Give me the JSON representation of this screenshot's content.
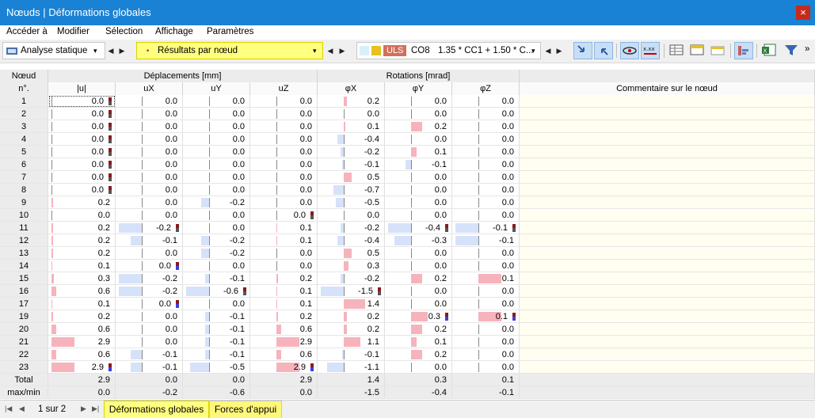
{
  "window": {
    "title": "Nœuds | Déformations globales",
    "close": "×"
  },
  "menu": [
    "Accéder à",
    "Modifier",
    "Sélection",
    "Affichage",
    "Paramètres"
  ],
  "toolbar": {
    "analysis": "Analyse statique",
    "results": "Résultats par nœud",
    "uls": "ULS",
    "combo_id": "CO8",
    "combo_expr": "1.35 * CC1 + 1.50 * C...",
    "more": "»",
    "colors": {
      "uls": "#d2705c",
      "highlight": "#ffff80",
      "combo_swatch": "#e8c020"
    }
  },
  "table": {
    "node_header": [
      "Nœud",
      "n°."
    ],
    "group_disp": "Déplacements [mm]",
    "group_rot": "Rotations [mrad]",
    "comment_header": "Commentaire sur le nœud",
    "columns": [
      "|u|",
      "uX",
      "uY",
      "uZ",
      "φX",
      "φY",
      "φZ"
    ],
    "rows": [
      {
        "n": "1",
        "v": [
          "0.0",
          "0.0",
          "0.0",
          "0.0",
          "0.2",
          "0.0",
          "0.0"
        ]
      },
      {
        "n": "2",
        "v": [
          "0.0",
          "0.0",
          "0.0",
          "0.0",
          "0.0",
          "0.0",
          "0.0"
        ]
      },
      {
        "n": "3",
        "v": [
          "0.0",
          "0.0",
          "0.0",
          "0.0",
          "0.1",
          "0.2",
          "0.0"
        ]
      },
      {
        "n": "4",
        "v": [
          "0.0",
          "0.0",
          "0.0",
          "0.0",
          "-0.4",
          "0.0",
          "0.0"
        ]
      },
      {
        "n": "5",
        "v": [
          "0.0",
          "0.0",
          "0.0",
          "0.0",
          "-0.2",
          "0.1",
          "0.0"
        ]
      },
      {
        "n": "6",
        "v": [
          "0.0",
          "0.0",
          "0.0",
          "0.0",
          "-0.1",
          "-0.1",
          "0.0"
        ]
      },
      {
        "n": "7",
        "v": [
          "0.0",
          "0.0",
          "0.0",
          "0.0",
          "0.5",
          "0.0",
          "0.0"
        ]
      },
      {
        "n": "8",
        "v": [
          "0.0",
          "0.0",
          "0.0",
          "0.0",
          "-0.7",
          "0.0",
          "0.0"
        ]
      },
      {
        "n": "9",
        "v": [
          "0.2",
          "0.0",
          "-0.2",
          "0.0",
          "-0.5",
          "0.0",
          "0.0"
        ]
      },
      {
        "n": "10",
        "v": [
          "0.0",
          "0.0",
          "0.0",
          "0.0",
          "0.0",
          "0.0",
          "0.0"
        ]
      },
      {
        "n": "11",
        "v": [
          "0.2",
          "-0.2",
          "0.0",
          "0.1",
          "-0.2",
          "-0.4",
          "-0.1"
        ]
      },
      {
        "n": "12",
        "v": [
          "0.2",
          "-0.1",
          "-0.2",
          "0.1",
          "-0.4",
          "-0.3",
          "-0.1"
        ]
      },
      {
        "n": "13",
        "v": [
          "0.2",
          "0.0",
          "-0.2",
          "0.0",
          "0.5",
          "0.0",
          "0.0"
        ]
      },
      {
        "n": "14",
        "v": [
          "0.1",
          "0.0",
          "0.0",
          "0.0",
          "0.3",
          "0.0",
          "0.0"
        ]
      },
      {
        "n": "15",
        "v": [
          "0.3",
          "-0.2",
          "-0.1",
          "0.2",
          "-0.2",
          "0.2",
          "0.1"
        ]
      },
      {
        "n": "16",
        "v": [
          "0.6",
          "-0.2",
          "-0.6",
          "0.1",
          "-1.5",
          "0.0",
          "0.0"
        ]
      },
      {
        "n": "17",
        "v": [
          "0.1",
          "0.0",
          "0.0",
          "0.1",
          "1.4",
          "0.0",
          "0.0"
        ]
      },
      {
        "n": "19",
        "v": [
          "0.2",
          "0.0",
          "-0.1",
          "0.2",
          "0.2",
          "0.3",
          "0.1"
        ]
      },
      {
        "n": "20",
        "v": [
          "0.6",
          "0.0",
          "-0.1",
          "0.6",
          "0.2",
          "0.2",
          "0.0"
        ]
      },
      {
        "n": "21",
        "v": [
          "2.9",
          "0.0",
          "-0.1",
          "2.9",
          "1.1",
          "0.1",
          "0.0"
        ]
      },
      {
        "n": "22",
        "v": [
          "0.6",
          "-0.1",
          "-0.1",
          "0.6",
          "-0.1",
          "0.2",
          "0.0"
        ]
      },
      {
        "n": "23",
        "v": [
          "2.9",
          "-0.1",
          "-0.5",
          "2.9",
          "-1.1",
          "0.0",
          "0.0"
        ]
      }
    ],
    "max_abs": [
      2.9,
      0.2,
      0.6,
      2.9,
      1.5,
      0.4,
      0.1
    ],
    "summary": [
      {
        "label": "Total",
        "v": [
          "2.9",
          "0.0",
          "0.0",
          "2.9",
          "1.4",
          "0.3",
          "0.1"
        ]
      },
      {
        "label": "max/min",
        "v": [
          "0.0",
          "-0.2",
          "-0.6",
          "0.0",
          "-1.5",
          "-0.4",
          "-0.1"
        ]
      }
    ],
    "extreme_markers": [
      {
        "row": "1",
        "col": 0,
        "kind": "red"
      },
      {
        "row": "2",
        "col": 0,
        "kind": "red"
      },
      {
        "row": "3",
        "col": 0,
        "kind": "red"
      },
      {
        "row": "4",
        "col": 0,
        "kind": "red"
      },
      {
        "row": "5",
        "col": 0,
        "kind": "red"
      },
      {
        "row": "6",
        "col": 0,
        "kind": "red"
      },
      {
        "row": "7",
        "col": 0,
        "kind": "red"
      },
      {
        "row": "8",
        "col": 0,
        "kind": "red"
      },
      {
        "row": "10",
        "col": 3,
        "kind": "red"
      },
      {
        "row": "11",
        "col": 1,
        "kind": "red"
      },
      {
        "row": "11",
        "col": 5,
        "kind": "red"
      },
      {
        "row": "11",
        "col": 6,
        "kind": "red"
      },
      {
        "row": "14",
        "col": 1,
        "kind": "blue"
      },
      {
        "row": "16",
        "col": 2,
        "kind": "red"
      },
      {
        "row": "16",
        "col": 4,
        "kind": "red"
      },
      {
        "row": "17",
        "col": 1,
        "kind": "blue"
      },
      {
        "row": "19",
        "col": 5,
        "kind": "blue"
      },
      {
        "row": "19",
        "col": 6,
        "kind": "blue"
      },
      {
        "row": "23",
        "col": 0,
        "kind": "blue"
      },
      {
        "row": "23",
        "col": 3,
        "kind": "blue"
      }
    ]
  },
  "footer": {
    "page": "1 sur 2",
    "tabs": [
      "Déformations globales",
      "Forces d'appui"
    ]
  }
}
